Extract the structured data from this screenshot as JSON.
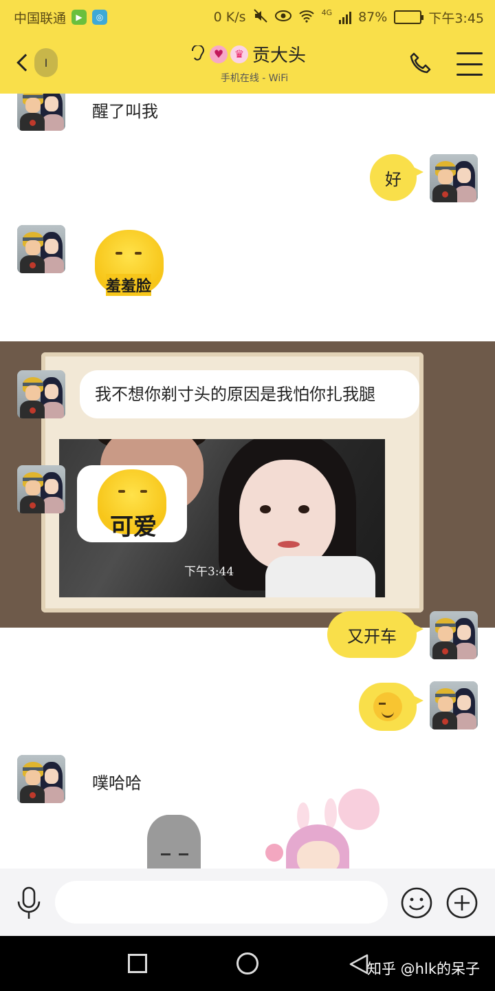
{
  "status_bar": {
    "carrier": "中国联通",
    "network_speed": "0 K/s",
    "network_type": "4G",
    "battery": "87%",
    "battery_level": 0.87,
    "time": "下午3:45"
  },
  "header": {
    "back_badge": "I",
    "contact_name": "贡大头",
    "contact_status": "手机在线 - WiFi",
    "icons": [
      "ear-icon",
      "pink-heart-key-icon",
      "crown-heart-icon"
    ]
  },
  "messages": [
    {
      "side": "received",
      "kind": "text",
      "text": "醒了叫我"
    },
    {
      "side": "sent",
      "kind": "text",
      "text": "好"
    },
    {
      "side": "received",
      "kind": "sticker",
      "sticker_text": "羞羞脸"
    },
    {
      "side": "received",
      "kind": "text",
      "text": "我不想你剃寸头的原因是我怕你扎我腿"
    },
    {
      "side": "received",
      "kind": "sticker",
      "sticker_text": "可爱"
    },
    {
      "side": "sent",
      "kind": "text",
      "text": "又开车"
    },
    {
      "side": "sent",
      "kind": "emoji",
      "emoji": "smirk-emoji"
    },
    {
      "side": "received",
      "kind": "text",
      "text": "噗哈哈"
    }
  ],
  "photo_timestamp": "下午3:44",
  "input": {
    "placeholder": ""
  },
  "watermark": "知乎 @hlk的呆子",
  "colors": {
    "accent": "#f9df4a",
    "nav": "#000000",
    "input_bar": "#f4f4f6"
  }
}
